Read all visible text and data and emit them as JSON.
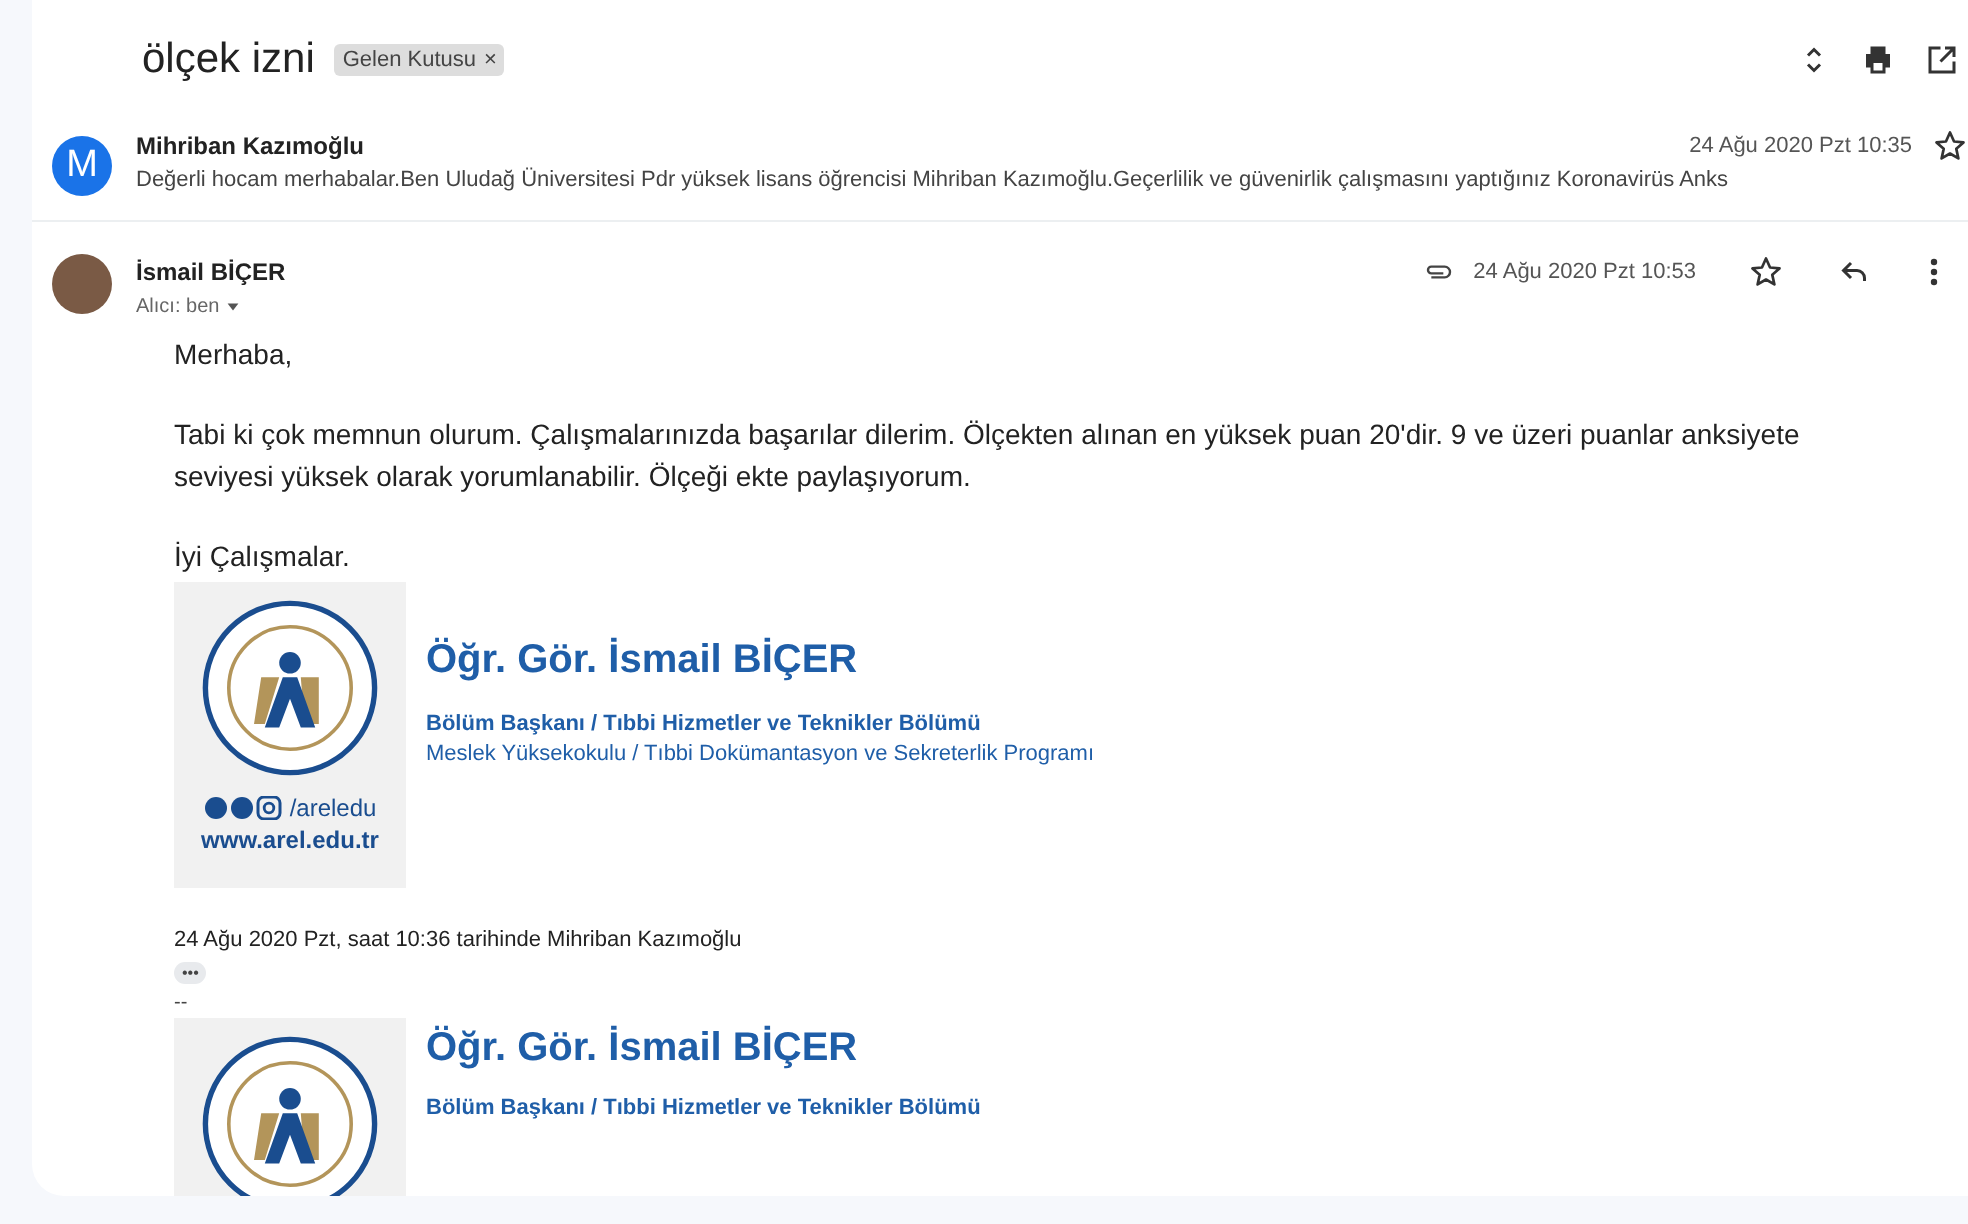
{
  "thread": {
    "subject": "ölçek izni",
    "label": {
      "text": "Gelen Kutusu",
      "remove": "×"
    }
  },
  "messages": [
    {
      "kind": "collapsed",
      "initial": "M",
      "sender": "Mihriban Kazımoğlu",
      "snippet": "Değerli hocam merhabalar.Ben Uludağ Üniversitesi Pdr yüksek lisans öğrencisi Mihriban Kazımoğlu.Geçerlilik ve güvenirlik çalışmasını yaptığınız Koronavirüs Anks",
      "date": "24 Ağu 2020 Pzt 10:35",
      "starred": false
    },
    {
      "kind": "expanded",
      "sender": "İsmail BİÇER",
      "recipient": "Alıcı: ben",
      "date": "24 Ağu 2020 Pzt 10:53",
      "has_attachment": true,
      "starred": false,
      "body": [
        "Merhaba,",
        "Tabi ki çok memnun olurum. Çalışmalarınızda başarılar dilerim. Ölçekten alınan en yüksek puan 20'dir. 9 ve üzeri puanlar anksiyete seviyesi yüksek olarak yorumlanabilir. Ölçeği ekte paylaşıyorum.",
        "İyi Çalışmalar."
      ],
      "signature": {
        "name": "Öğr. Gör. İsmail BİÇER",
        "title": "Bölüm Başkanı / Tıbbi Hizmetler ve Teknikler Bölümü",
        "program": "Meslek Yüksekokulu / Tıbbi Dokümantasyon ve Sekreterlik Programı",
        "social": "/areledu",
        "website": "www.arel.edu.tr"
      },
      "quote_header": "24 Ağu 2020 Pzt, saat 10:36 tarihinde Mihriban Kazımoğlu",
      "quote_toggle": "•••",
      "separator": "--",
      "quoted_signature": {
        "name": "Öğr. Gör. İsmail BİÇER",
        "title": "Bölüm Başkanı / Tıbbi Hizmetler ve Teknikler Bölümü"
      }
    }
  ]
}
